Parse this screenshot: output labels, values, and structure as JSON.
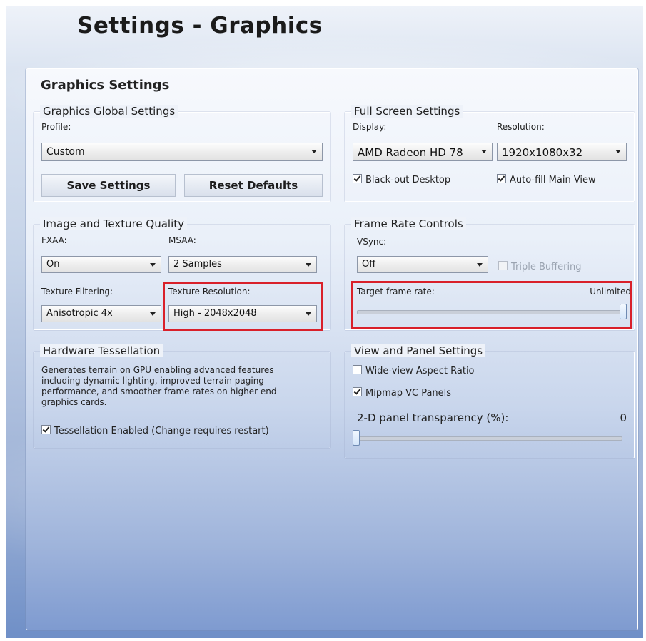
{
  "page_title": "Settings - Graphics",
  "panel_title": "Graphics Settings",
  "global": {
    "legend": "Graphics Global Settings",
    "profile_label": "Profile:",
    "profile_value": "Custom",
    "save_label": "Save Settings",
    "reset_label": "Reset Defaults"
  },
  "fullscreen": {
    "legend": "Full Screen Settings",
    "display_label": "Display:",
    "display_value": "AMD Radeon HD 78",
    "resolution_label": "Resolution:",
    "resolution_value": "1920x1080x32",
    "blackout_label": "Black-out Desktop",
    "blackout_checked": true,
    "autofill_label": "Auto-fill Main View",
    "autofill_checked": true
  },
  "image_quality": {
    "legend": "Image and Texture Quality",
    "fxaa_label": "FXAA:",
    "fxaa_value": "On",
    "msaa_label": "MSAA:",
    "msaa_value": "2 Samples",
    "filtering_label": "Texture Filtering:",
    "filtering_value": "Anisotropic 4x",
    "tex_res_label": "Texture Resolution:",
    "tex_res_value": "High - 2048x2048"
  },
  "frame_rate": {
    "legend": "Frame Rate Controls",
    "vsync_label": "VSync:",
    "vsync_value": "Off",
    "triple_label": "Triple Buffering",
    "triple_checked": false,
    "target_label": "Target frame rate:",
    "target_value": "Unlimited",
    "target_slider_fraction": 1.0
  },
  "tessellation": {
    "legend": "Hardware Tessellation",
    "description": "Generates terrain on GPU enabling advanced features including dynamic lighting, improved terrain paging performance, and smoother frame rates on higher end graphics cards.",
    "enabled_label": "Tessellation Enabled (Change requires restart)",
    "enabled_checked": true
  },
  "view_panel": {
    "legend": "View and Panel Settings",
    "wide_label": "Wide-view Aspect Ratio",
    "wide_checked": false,
    "mipmap_label": "Mipmap VC Panels",
    "mipmap_checked": true,
    "transparency_label": "2-D panel transparency (%):",
    "transparency_value": "0",
    "transparency_slider_fraction": 0.0
  },
  "colors": {
    "highlight": "#d9202a"
  }
}
